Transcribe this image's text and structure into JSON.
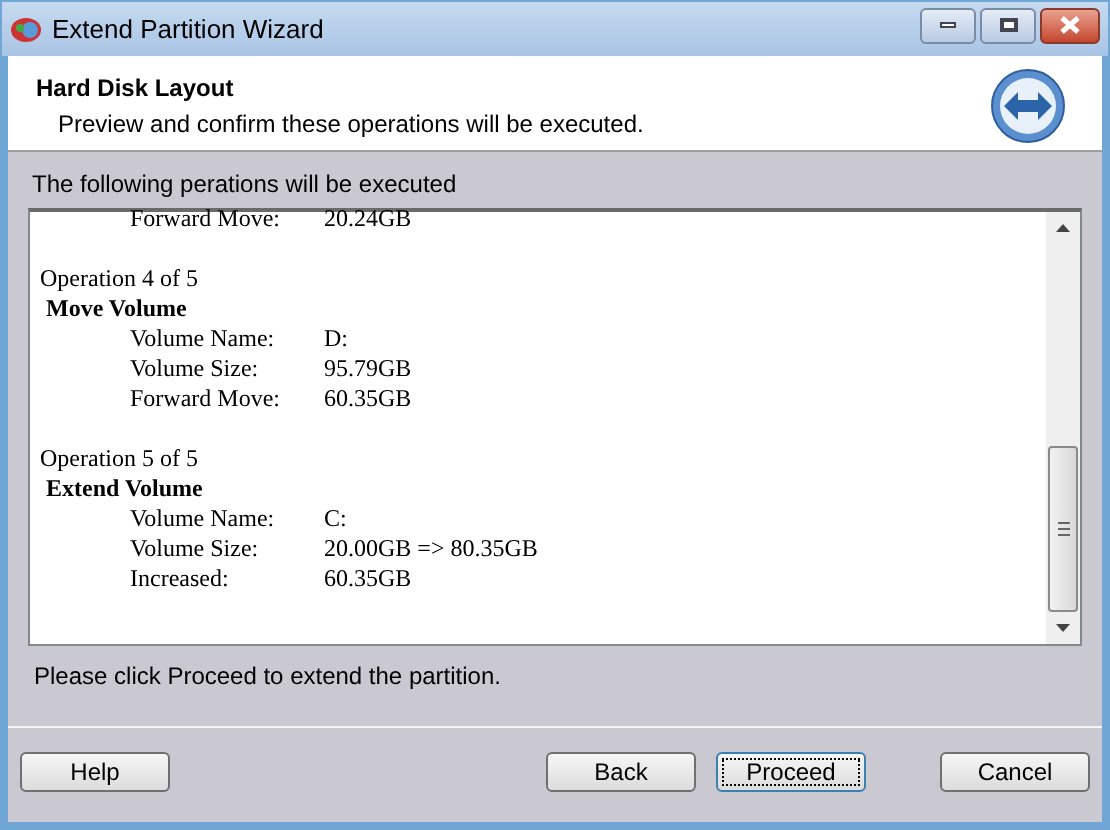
{
  "window": {
    "title": "Extend Partition Wizard"
  },
  "header": {
    "title": "Hard Disk Layout",
    "subtitle": "Preview and confirm these operations will be executed."
  },
  "list_caption": "The following perations will be executed",
  "operations": [
    {
      "fields": [
        {
          "label": "Forward Move:",
          "value": "20.24GB"
        }
      ]
    },
    {
      "heading": "Operation 4 of 5",
      "title": "Move Volume",
      "fields": [
        {
          "label": "Volume Name:",
          "value": "D:"
        },
        {
          "label": "Volume Size:",
          "value": "95.79GB"
        },
        {
          "label": "Forward Move:",
          "value": "60.35GB"
        }
      ]
    },
    {
      "heading": "Operation 5 of 5",
      "title": "Extend Volume",
      "fields": [
        {
          "label": "Volume Name:",
          "value": "C:"
        },
        {
          "label": "Volume Size:",
          "value": "20.00GB => 80.35GB"
        },
        {
          "label": "Increased:",
          "value": "60.35GB"
        }
      ]
    }
  ],
  "hint": "Please click Proceed to extend the partition.",
  "buttons": [
    {
      "label": "Help",
      "focused": false
    },
    {
      "label": "Back",
      "focused": false
    },
    {
      "label": "Proceed",
      "focused": true
    },
    {
      "label": "Cancel",
      "focused": false
    }
  ]
}
